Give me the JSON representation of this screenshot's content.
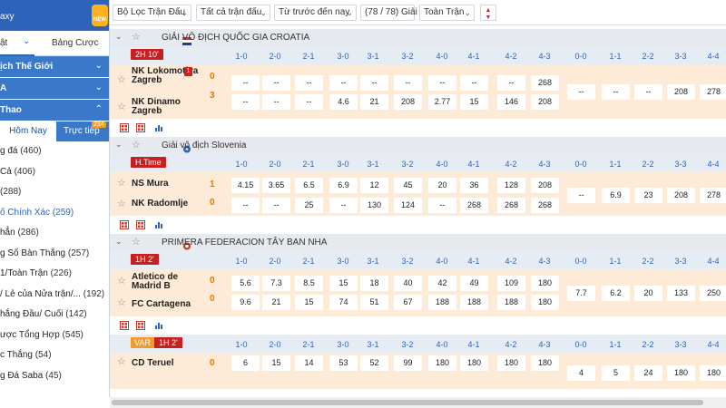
{
  "sidebar": {
    "brand": "axy",
    "new_badge": "NEW",
    "lang_select": "ật",
    "odds_table_tab": "Bảng Cược",
    "section_world": "ịch Thế Giới",
    "section_a": "A",
    "section_sports": "Thao",
    "subtab_today": "Hôm Nay",
    "subtab_live": "Trực tiếp",
    "live_count": "234",
    "items": [
      {
        "label": "g đá",
        "count": "(460)"
      },
      {
        "label": "Cả",
        "count": "(406)"
      },
      {
        "label": "",
        "count": "(288)"
      },
      {
        "label": "ố Chính Xác",
        "count": "(259)"
      },
      {
        "label": "hẳn",
        "count": "(286)"
      },
      {
        "label": "g Số Bàn Thắng",
        "count": "(257)"
      },
      {
        "label": "1/Toàn Trận",
        "count": "(226)"
      },
      {
        "label": "/ Lẻ của Nửa trận/...",
        "count": "(192)"
      },
      {
        "label": "hắng Đầu/ Cuối",
        "count": "(142)"
      },
      {
        "label": "ược Tổng Hợp",
        "count": "(545)"
      },
      {
        "label": "c Thắng",
        "count": "(54)"
      },
      {
        "label": "g Đá Saba",
        "count": "(45)"
      }
    ]
  },
  "toolbar": {
    "filter_match": "Bộ Lọc Trận Đấu",
    "all_matches": "Tất cả trận đấu",
    "date_range": "Từ trước đến nay",
    "league_count": "(78 / 78) Giải",
    "full_match": "Toàn Trận"
  },
  "scores_header": [
    "1-0",
    "2-0",
    "2-1",
    "3-0",
    "3-1",
    "3-2",
    "4-0",
    "4-1",
    "4-2",
    "4-3",
    "0-0",
    "1-1",
    "2-2",
    "3-3",
    "4-4"
  ],
  "leagues": [
    {
      "name": "GIẢI VÔ ĐỊCH QUỐC GIA CROATIA",
      "status": "2H 10'",
      "home": "NK Lokomotiva Zagreb",
      "away": "NK Dinamo Zagreb",
      "home_goals": "0",
      "away_goals": "3",
      "red_card": "1",
      "home_odds": [
        "--",
        "--",
        "--",
        "--",
        "--",
        "--",
        "--",
        "--",
        "--",
        "268"
      ],
      "away_odds": [
        "--",
        "--",
        "--",
        "4.6",
        "21",
        "208",
        "2.77",
        "15",
        "146",
        "208"
      ],
      "draw_odds": [
        "--",
        "--",
        "--",
        "208",
        "278"
      ]
    },
    {
      "name": "Giải vô địch Slovenia",
      "status": "H.Time",
      "home": "NS Mura",
      "away": "NK Radomlje",
      "home_goals": "1",
      "away_goals": "0",
      "home_odds": [
        "4.15",
        "3.65",
        "6.5",
        "6.9",
        "12",
        "45",
        "20",
        "36",
        "128",
        "208"
      ],
      "away_odds": [
        "--",
        "--",
        "25",
        "--",
        "130",
        "124",
        "--",
        "268",
        "268",
        "268"
      ],
      "draw_odds": [
        "--",
        "6.9",
        "23",
        "208",
        "278"
      ]
    },
    {
      "name": "PRIMERA FEDERACION TÂY BAN NHA",
      "status": "1H 2'",
      "home": "Atletico de Madrid B",
      "away": "FC Cartagena",
      "home_goals": "0",
      "away_goals": "0",
      "home_odds": [
        "5.6",
        "7.3",
        "8.5",
        "15",
        "18",
        "40",
        "42",
        "49",
        "109",
        "180"
      ],
      "away_odds": [
        "9.6",
        "21",
        "15",
        "74",
        "51",
        "67",
        "188",
        "188",
        "188",
        "180"
      ],
      "draw_odds": [
        "7.7",
        "6.2",
        "20",
        "133",
        "250"
      ]
    },
    {
      "var_label": "VAR",
      "status": "1H 2'",
      "home": "CD Teruel",
      "home_goals": "0",
      "home_odds": [
        "6",
        "15",
        "14",
        "53",
        "52",
        "99",
        "180",
        "180",
        "180",
        "180"
      ],
      "draw_odds": [
        "4",
        "5",
        "24",
        "180",
        "180"
      ]
    }
  ],
  "colors": {
    "accent": "#2d63b8",
    "row_bg": "#fdebd8",
    "live_red": "#c62020",
    "goal_orange": "#e07a00"
  }
}
